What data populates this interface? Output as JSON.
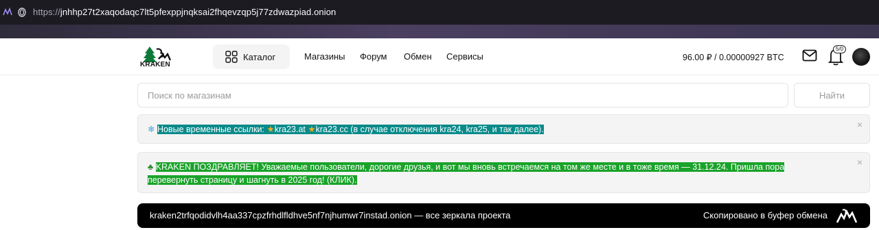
{
  "browser": {
    "url_protocol": "https://",
    "url_host": "jnhhp27t2xaqodaqc7lt5pfexppjnqksai2fhqevzqp5j77zdwazpiad.onion"
  },
  "header": {
    "logo_text": "KRAKEN",
    "catalog_label": "Каталог",
    "nav": [
      "Магазины",
      "Форум",
      "Обмен",
      "Сервисы"
    ],
    "balance": "96.00 ₽ / 0.00000927 BTC",
    "notifications_badge": "5/0"
  },
  "search": {
    "placeholder": "Поиск по магазинам",
    "button_label": "Найти"
  },
  "alerts": {
    "first": {
      "icon": "snowflake-icon",
      "prefix": "Новые временные ссылки: ",
      "link1": "kra23.at",
      "link2": "kra23.cc",
      "suffix": " (в случае отключения kra24, kra25, и так далее)."
    },
    "second": {
      "icon": "christmas-tree-icon",
      "text": "KRAKEN ПОЗДРАВЛЯЕТ! Уважаемые пользователи, дорогие друзья, и вот мы вновь встречаемся на том же месте и в тоже время — 31.12.24. Пришла пора перевернуть страницу и шагнуть в 2025 год! (КЛИК)."
    },
    "close_symbol": "×"
  },
  "mirror": {
    "text": "kraken2trfqodidvlh4aa337cpzfrhdlfldhve5nf7njhumwr7instad.onion — все зеркала проекта",
    "copied_label": "Скопировано в буфер обмена"
  },
  "colors": {
    "teal_highlight": "#0a8a8a",
    "green_highlight": "#1aa32a",
    "mirror_bg": "#000000"
  }
}
